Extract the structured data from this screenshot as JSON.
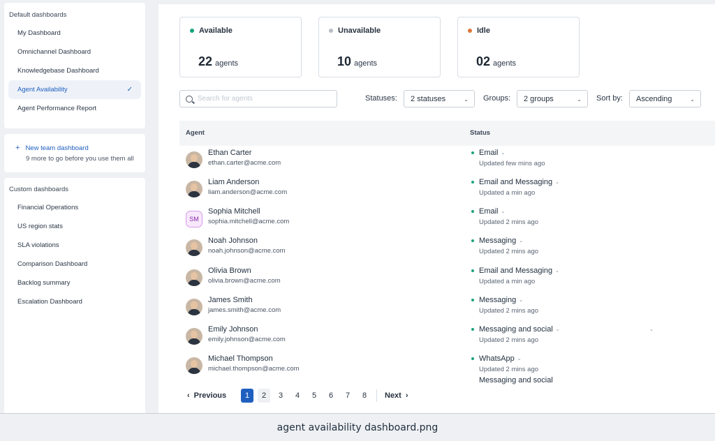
{
  "sidebar": {
    "default_heading": "Default dashboards",
    "default_items": [
      {
        "label": "My Dashboard"
      },
      {
        "label": "Omnichannel Dashboard"
      },
      {
        "label": "Knowledgebase Dashboard"
      },
      {
        "label": "Agent Availability",
        "active": true
      },
      {
        "label": "Agent Performance Report"
      }
    ],
    "new_team": {
      "icon": "plus-icon",
      "label": "New team dashboard",
      "sub": "9 more to go before you use them all"
    },
    "custom_heading": "Custom dashboards",
    "custom_items": [
      {
        "label": "Financial Operations"
      },
      {
        "label": "US region stats"
      },
      {
        "label": "SLA violations"
      },
      {
        "label": "Comparison Dashboard"
      },
      {
        "label": "Backlog summary"
      },
      {
        "label": "Escalation Dashboard"
      }
    ]
  },
  "stats": [
    {
      "label": "Available",
      "value": "22",
      "unit": "agents",
      "color": "#14a37a"
    },
    {
      "label": "Unavailable",
      "value": "10",
      "unit": "agents",
      "color": "#b8bec6"
    },
    {
      "label": "Idle",
      "value": "02",
      "unit": "agents",
      "color": "#e0763a"
    }
  ],
  "filters": {
    "search_placeholder": "Search for agents",
    "statuses_label": "Statuses:",
    "statuses_value": "2 statuses",
    "groups_label": "Groups:",
    "groups_value": "2 groups",
    "sort_label": "Sort by:",
    "sort_value": "Ascending"
  },
  "table": {
    "headers": {
      "agent": "Agent",
      "status": "Status"
    },
    "rows": [
      {
        "name": "Ethan Carter",
        "email": "ethan.carter@acme.com",
        "status": "Email",
        "updated": "Updated few mins ago"
      },
      {
        "name": "Liam Anderson",
        "email": "liam.anderson@acme.com",
        "status": "Email and Messaging",
        "updated": "Updated a min ago"
      },
      {
        "name": "Sophia Mitchell",
        "email": "sophia.mitchell@acme.com",
        "status": "Email",
        "updated": "Updated 2 mins ago",
        "initials": "SM"
      },
      {
        "name": "Noah Johnson",
        "email": "noah.johnson@acme.com",
        "status": "Messaging",
        "updated": "Updated 2 mins ago"
      },
      {
        "name": "Olivia Brown",
        "email": "olivia.brown@acme.com",
        "status": "Email and Messaging",
        "updated": "Updated a min ago"
      },
      {
        "name": "James Smith",
        "email": "james.smith@acme.com",
        "status": "Messaging",
        "updated": "Updated 2 mins ago"
      },
      {
        "name": "Emily Johnson",
        "email": "emily.johnson@acme.com",
        "status": "Messaging and social",
        "updated": "Updated 2 mins ago"
      },
      {
        "name": "Michael Thompson",
        "email": "michael.thompson@acme.com",
        "status": "WhatsApp",
        "updated": "Updated 2 mins ago",
        "extra": "Messaging and social"
      }
    ]
  },
  "pagination": {
    "previous": "Previous",
    "next": "Next",
    "pages": [
      "1",
      "2",
      "3",
      "4",
      "5",
      "6",
      "7",
      "8"
    ],
    "current": "1"
  },
  "footer_caption": "agent availability dashboard.png"
}
